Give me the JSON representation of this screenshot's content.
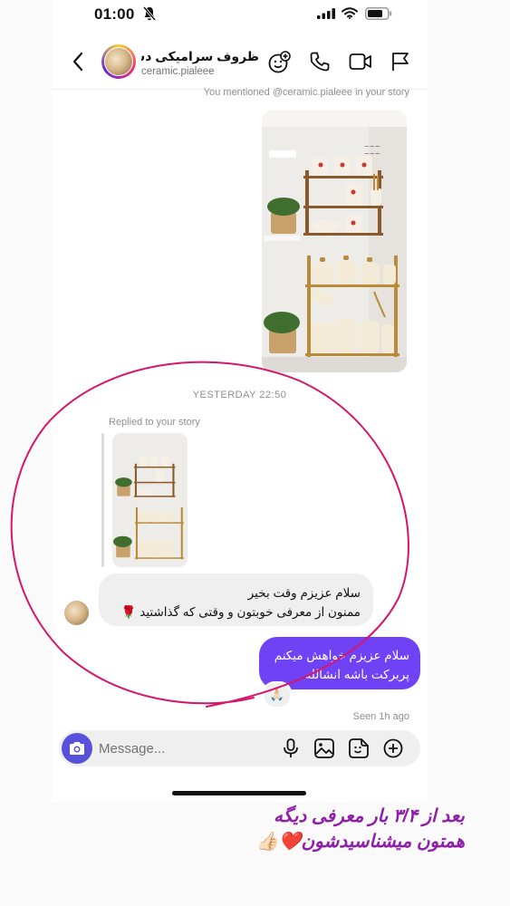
{
  "status_bar": {
    "time": "01:00"
  },
  "header": {
    "name": "ظروف سرامیکی دس...",
    "handle": "ceramic.pialeee"
  },
  "chat": {
    "mention_note": "You mentioned @ceramic.pialeee in your story",
    "timestamp": "YESTERDAY 22:50",
    "replied_note": "Replied to your story",
    "incoming": {
      "line1": "سلام عزیزم وقت بخیر",
      "line2": "ممنون از معرفی خوبتون و وقتی که گذاشتید 🌹"
    },
    "outgoing": {
      "line1": "سلام عزیزم خواهش میکنم",
      "line2": "پربرکت باشه انشالله",
      "reaction": "🙏🏻"
    },
    "seen": "Seen 1h ago"
  },
  "composer": {
    "placeholder": "Message..."
  },
  "caption": {
    "line1": "بعد از ۳/۴ بار معرفی دیگه",
    "line2": "همتون میشناسیدشون❤️👍🏻"
  },
  "colors": {
    "outgoing_bubble": "#6f42f5",
    "camera_button": "#5851db",
    "annotation_ellipse": "#d6156c",
    "caption_text": "#8e1fa8"
  }
}
